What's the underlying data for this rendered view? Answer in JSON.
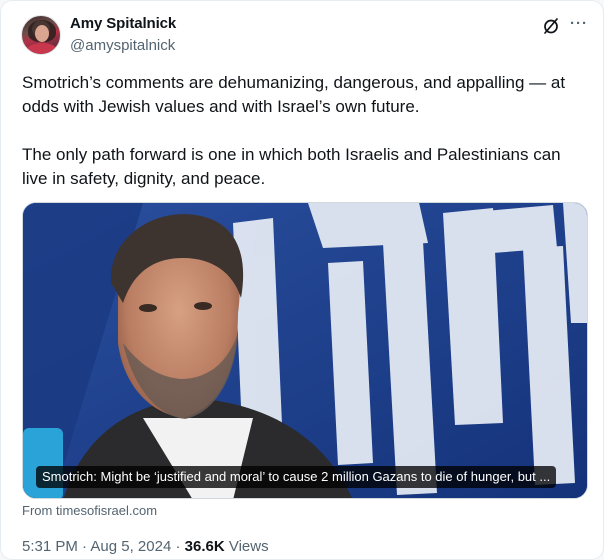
{
  "author": {
    "name": "Amy Spitalnick",
    "handle": "@amyspitalnick"
  },
  "icons": {
    "grok": "grok-icon",
    "more": "more-options-icon"
  },
  "tweet": {
    "paragraph_1": "Smotrich’s comments are dehumanizing, dangerous, and appalling — at odds with Jewish values and with Israel’s own future.",
    "paragraph_2": "The only path forward is one in which both Israelis and Palestinians can live in safety, dignity, and peace."
  },
  "card": {
    "caption": "Smotrich: Might be ‘justified and moral’ to cause 2 million Gazans to die of hunger, but ...",
    "source": "From timesofisrael.com"
  },
  "meta": {
    "time": "5:31 PM",
    "separator_1": " · ",
    "date": "Aug 5, 2024",
    "separator_2": " · ",
    "views_count": "36.6K",
    "views_label": " Views"
  },
  "colors": {
    "secondary_text": "#536471",
    "primary_text": "#0f1419",
    "banner_blue": "#1f3f8a"
  }
}
